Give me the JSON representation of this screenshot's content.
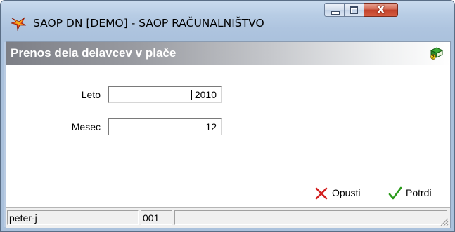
{
  "window": {
    "title": "SAOP DN [DEMO] - SAOP RAČUNALNIŠTVO",
    "app_icon": "saop-logo-icon",
    "controls": {
      "minimize_icon": "minimize-icon",
      "maximize_icon": "maximize-icon",
      "close_label": "X"
    }
  },
  "dialog": {
    "title": "Prenos dela delavcev v plače",
    "help_icon": "book-help-icon"
  },
  "form": {
    "fields": [
      {
        "label": "Leto",
        "value": "2010"
      },
      {
        "label": "Mesec",
        "value": "12"
      }
    ]
  },
  "actions": {
    "cancel_label": "Opusti",
    "cancel_icon": "red-x-icon",
    "confirm_label": "Potrdi",
    "confirm_icon": "green-check-icon"
  },
  "statusbar": {
    "user": "peter-j",
    "code": "001",
    "extra": ""
  },
  "colors": {
    "title_bar": "#b8cde5",
    "header_band_start": "#7d7f86",
    "close_button": "#c2422b",
    "cancel_icon": "#d31f1f",
    "confirm_icon": "#2a9a1a"
  }
}
